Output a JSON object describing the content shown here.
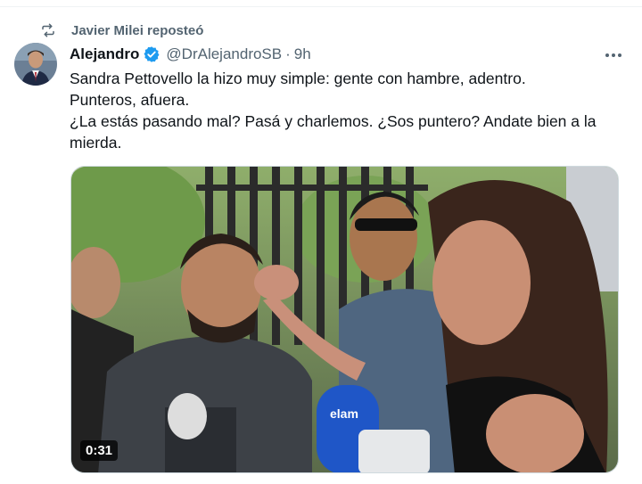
{
  "repost": {
    "label": "Javier Milei reposteó",
    "icon": "repost-icon"
  },
  "author": {
    "display_name": "Alejandro",
    "handle": "@DrAlejandroSB",
    "separator": "·",
    "time": "9h",
    "verified": true,
    "verified_color": "#1d9bf0"
  },
  "menu": {
    "icon": "more-icon"
  },
  "tweet": {
    "lines": [
      "Sandra Pettovello la hizo muy simple: gente con hambre, adentro.",
      "Punteros, afuera.",
      "¿La estás pasando mal? Pasá y charlemos. ¿Sos puntero? Andate bien a la",
      "mierda."
    ]
  },
  "media": {
    "type": "video",
    "duration": "0:31",
    "microphone_brand": "elam"
  },
  "colors": {
    "text": "#0f1419",
    "secondary": "#536471",
    "accent": "#1d9bf0"
  }
}
